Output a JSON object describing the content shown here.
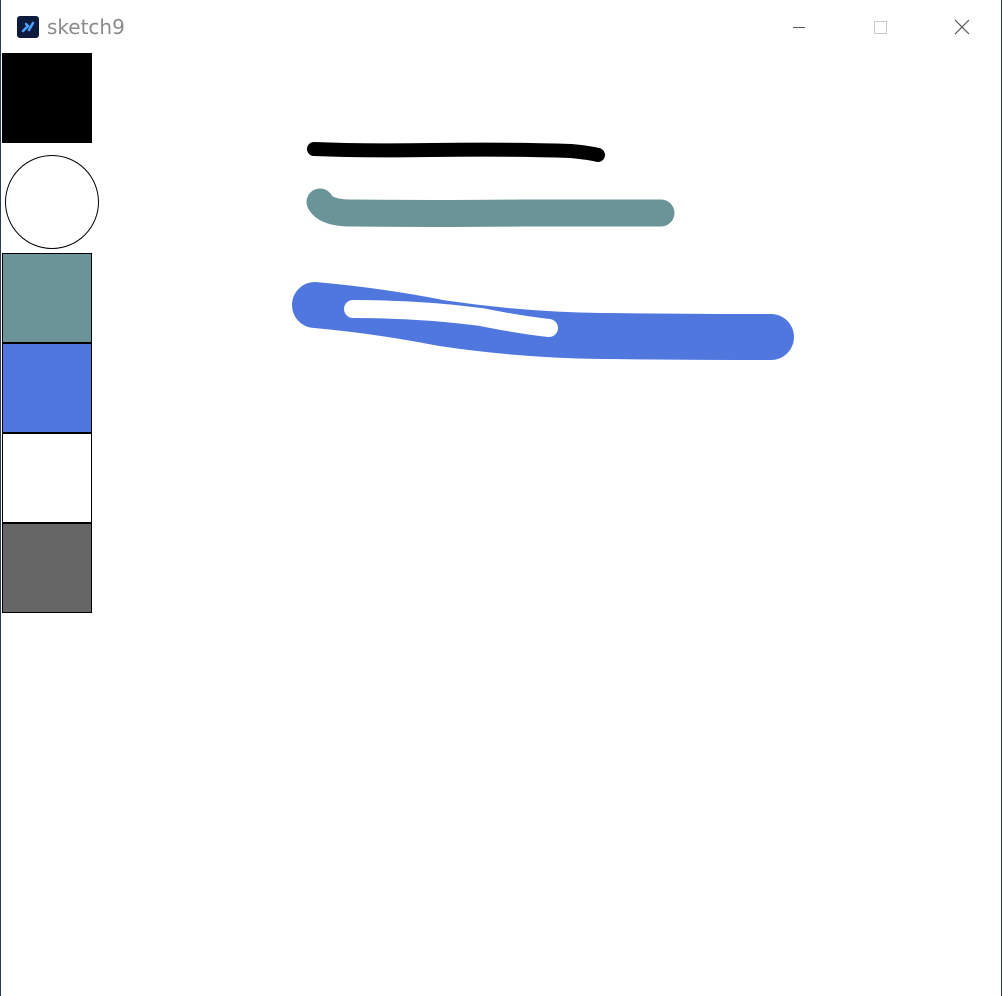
{
  "window": {
    "title": "sketch9",
    "icon": "processing-app-icon",
    "controls": [
      "minimize-icon",
      "maximize-icon",
      "close-icon"
    ]
  },
  "palette": {
    "swatches": [
      {
        "name": "black",
        "color": "#000000"
      },
      {
        "name": "slate-teal",
        "color": "#6b9499"
      },
      {
        "name": "royal-blue",
        "color": "#5077de"
      },
      {
        "name": "white",
        "color": "#ffffff"
      },
      {
        "name": "gray",
        "color": "#666666"
      }
    ],
    "brush_indicator_color": "#ffffff"
  },
  "strokes": [
    {
      "color": "#000000",
      "label": "black-stroke"
    },
    {
      "color": "#6b9499",
      "label": "teal-stroke"
    },
    {
      "color": "#5077de",
      "label": "blue-stroke"
    },
    {
      "color": "#ffffff",
      "label": "white-stroke"
    }
  ]
}
